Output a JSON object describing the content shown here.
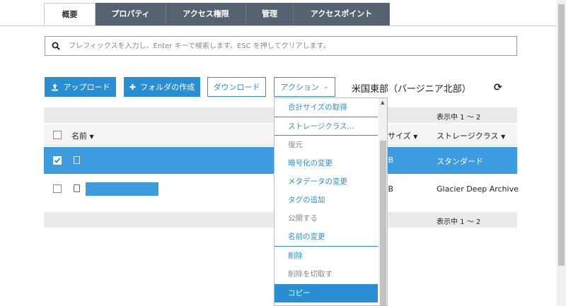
{
  "tabs": [
    "概要",
    "プロパティ",
    "アクセス権限",
    "管理",
    "アクセスポイント"
  ],
  "search": {
    "placeholder": "プレフィックスを入力し、Enter キーで検索します。ESC を押してクリアします。"
  },
  "toolbar": {
    "upload": "アップロード",
    "create_folder": "フォルダの作成",
    "download": "ダウンロード",
    "actions": "アクション"
  },
  "region": "米国東部（バージニア北部）",
  "showing_top": "表示中 1 ～ 2",
  "showing_bottom": "表示中 1 ～ 2",
  "table": {
    "col_name": "名前",
    "col_size": "サイズ",
    "col_storage": "ストレージクラス",
    "rows": [
      {
        "size": "GB",
        "storage": "スタンダード"
      },
      {
        "size": "GB",
        "storage": "Glacier Deep Archive"
      }
    ]
  },
  "actions_menu": [
    {
      "label": "合計サイズの取得",
      "state": "enabled"
    },
    {
      "label": "ストレージクラス...",
      "state": "enabled"
    },
    {
      "label": "復元",
      "state": "disabled"
    },
    {
      "label": "暗号化の変更",
      "state": "enabled"
    },
    {
      "label": "メタデータの変更",
      "state": "enabled"
    },
    {
      "label": "タグの追加",
      "state": "enabled"
    },
    {
      "label": "公開する",
      "state": "disabled"
    },
    {
      "label": "名前の変更",
      "state": "enabled"
    },
    {
      "label": "削除",
      "state": "enabled"
    },
    {
      "label": "削除を切取す",
      "state": "disabled"
    },
    {
      "label": "コピー",
      "state": "active"
    }
  ],
  "colors": {
    "accent": "#2a8ed2",
    "tab_bg": "#556270",
    "selected_row": "#3d9cde"
  }
}
